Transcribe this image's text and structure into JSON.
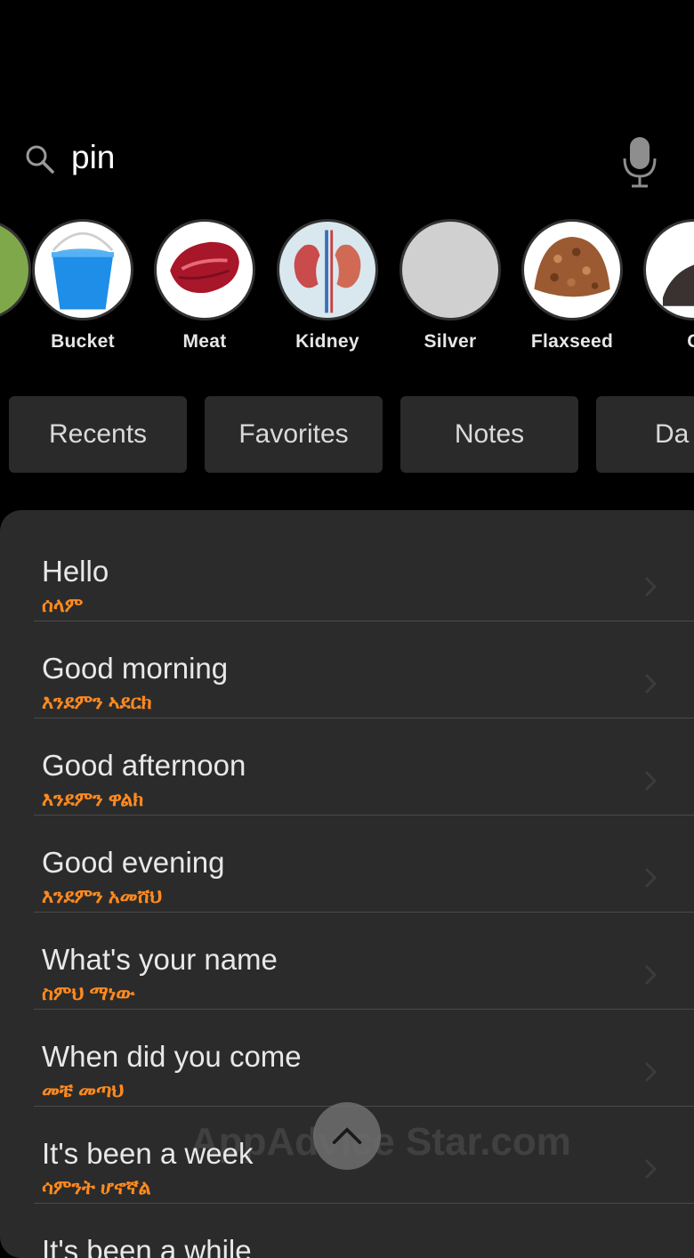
{
  "search": {
    "value": "pin"
  },
  "categories": [
    {
      "label": "",
      "icon": "leaf-icon"
    },
    {
      "label": "Bucket",
      "icon": "bucket-icon"
    },
    {
      "label": "Meat",
      "icon": "meat-icon"
    },
    {
      "label": "Kidney",
      "icon": "kidney-icon"
    },
    {
      "label": "Silver",
      "icon": "silver-icon"
    },
    {
      "label": "Flaxseed",
      "icon": "flaxseed-icon"
    },
    {
      "label": "C",
      "icon": "animal-icon"
    }
  ],
  "tabs": [
    {
      "label": "Recents"
    },
    {
      "label": "Favorites"
    },
    {
      "label": "Notes"
    },
    {
      "label": "Da"
    }
  ],
  "phrases": [
    {
      "en": "Hello",
      "am": "ሰላም"
    },
    {
      "en": "Good morning",
      "am": "እንደምን ኣደርክ"
    },
    {
      "en": "Good afternoon",
      "am": "እንደምን ዋልክ"
    },
    {
      "en": "Good evening",
      "am": "እንደምን አመሸህ"
    },
    {
      "en": "What's your name",
      "am": "ስምህ ማነው"
    },
    {
      "en": "When did you come",
      "am": "መቼ መጣህ"
    },
    {
      "en": "It's been a week",
      "am": "ሳምንት ሆኖኛል"
    },
    {
      "en": "It's been a while",
      "am": ""
    }
  ],
  "watermark": "AppAdvice Star.com",
  "colors": {
    "accent": "#ff8a1e",
    "list_bg": "#2b2b2b",
    "tab_bg": "#2a2a2a"
  }
}
